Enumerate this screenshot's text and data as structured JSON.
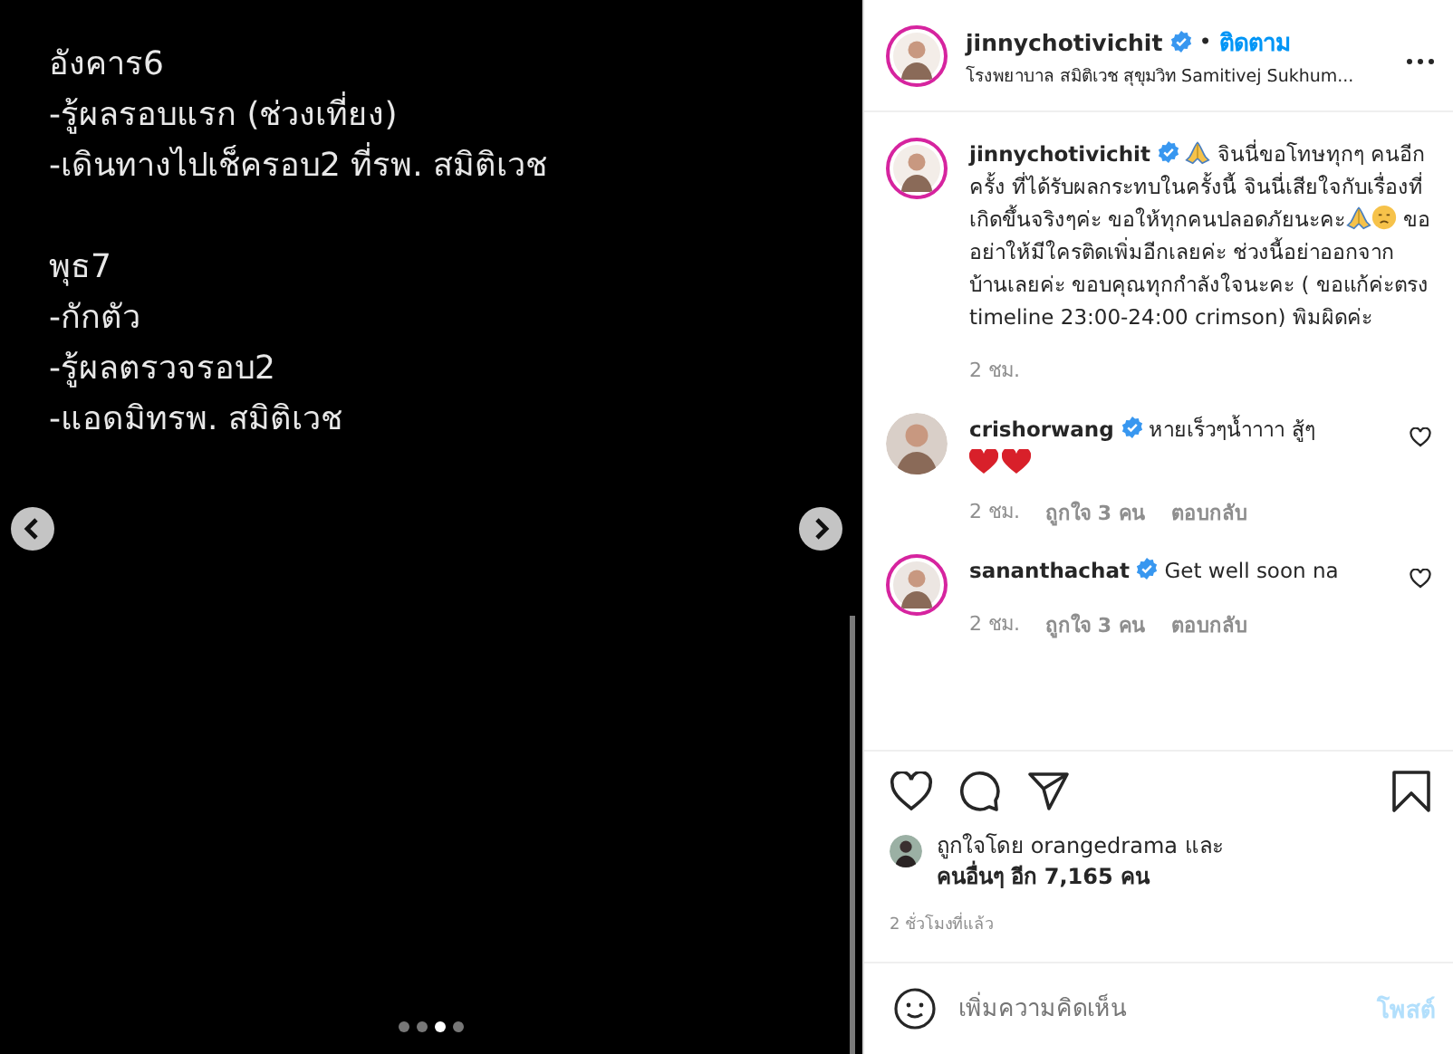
{
  "post_image": {
    "blocks": [
      {
        "lines": [
          "อังคาร6",
          "-รู้ผลรอบแรก (ช่วงเที่ยง)",
          "-เดินทางไปเช็ครอบ2 ที่รพ. สมิติเวช"
        ]
      },
      {
        "lines": [
          "พุธ7",
          "-กักตัว",
          "-รู้ผลตรวจรอบ2",
          "-แอดมิทรพ. สมิติเวช"
        ]
      }
    ]
  },
  "carousel": {
    "dots": [
      {
        "selected": false
      },
      {
        "selected": false
      },
      {
        "selected": true
      },
      {
        "selected": false
      }
    ]
  },
  "header": {
    "username": "jinnychotivichit",
    "verified": true,
    "separator": "•",
    "follow": "ติดตาม",
    "location": "โรงพยาบาล สมิติเวช สุขุมวิท Samitivej Sukhum..."
  },
  "caption": {
    "username": "jinnychotivichit",
    "verified": true,
    "parts": [
      {
        "kind": "pray"
      },
      {
        "kind": "text",
        "text": " จินนี่ขอโทษทุกๆ คนอีกครั้ง ที่ได้รับผลกระทบในครั้งนี้ จินนี่เสียใจกับเรื่องที่เกิดขึ้นจริงๆค่ะ ขอให้ทุกคนปลอดภัยนะคะ"
      },
      {
        "kind": "pray"
      },
      {
        "kind": "sad"
      },
      {
        "kind": "text",
        "text": " ขออย่าให้มีใครติดเพิ่มอีกเลยค่ะ ช่วงนี้อย่าออกจากบ้านเลยค่ะ ขอบคุณทุกกำลังใจนะคะ ( ขอแก้ค่ะตรง timeline 23:00-24:00 crimson) พิมผิดค่ะ"
      }
    ],
    "time": "2 ชม."
  },
  "comments": [
    {
      "username": "crishorwang",
      "verified": true,
      "story_ring": false,
      "text": "หายเร็วๆน้ำาาา สู้ๆ",
      "emoji": [
        {
          "kind": "heart"
        },
        {
          "kind": "heart"
        }
      ],
      "time": "2 ชม.",
      "likes": "ถูกใจ 3 คน",
      "reply": "ตอบกลับ"
    },
    {
      "username": "sananthachat",
      "verified": true,
      "story_ring": true,
      "text": "Get well soon na",
      "time": "2 ชม.",
      "likes": "ถูกใจ 3 คน",
      "reply": "ตอบกลับ"
    }
  ],
  "likes": {
    "line1": "ถูกใจโดย orangedrama และ",
    "line2": "คนอื่นๆ อีก 7,165 คน"
  },
  "posted": "2 ชั่วโมงที่แล้ว",
  "comment_box": {
    "placeholder": "เพิ่มความคิดเห็น",
    "post": "โพสต์"
  }
}
